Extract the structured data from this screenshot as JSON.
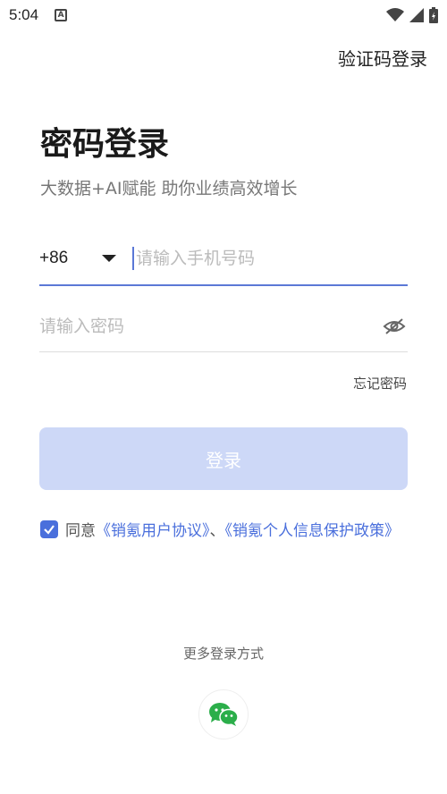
{
  "status_bar": {
    "time": "5:04",
    "notification_icon": "a-notification-icon",
    "icons": [
      "wifi-icon",
      "signal-icon",
      "battery-icon"
    ]
  },
  "header": {
    "switch_link": "验证码登录"
  },
  "main": {
    "title": "密码登录",
    "subtitle": "大数据+AI赋能  助你业绩高效增长"
  },
  "phone": {
    "country_code": "+86",
    "placeholder": "请输入手机号码",
    "value": ""
  },
  "password": {
    "placeholder": "请输入密码",
    "value": "",
    "visibility_icon": "eye-off-icon"
  },
  "forgot_password": "忘记密码",
  "login_button": "登录",
  "agreement": {
    "checked": true,
    "prefix": "同意",
    "link1": "《销氪用户协议》",
    "separator": "、",
    "link2": "《销氪个人信息保护政策》"
  },
  "more_login": {
    "label": "更多登录方式",
    "wechat_icon": "wechat-icon"
  },
  "colors": {
    "accent": "#4a6fdc",
    "button_disabled": "#cdd8f7",
    "wechat": "#2bae4a"
  }
}
